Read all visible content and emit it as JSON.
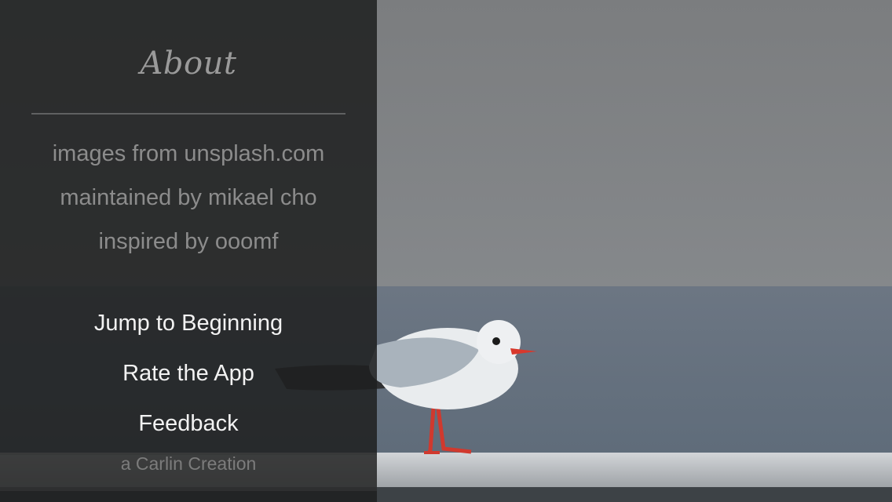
{
  "sidebar": {
    "title": "About",
    "credits": [
      "images from unsplash.com",
      "maintained by mikael cho",
      "inspired by ooomf"
    ],
    "menu": [
      "Jump to Beginning",
      "Rate the App",
      "Feedback"
    ],
    "signature": "a Carlin Creation"
  },
  "background": {
    "subject": "seagull-photo",
    "colors": {
      "sky": "#7d8083",
      "sea": "#66717c",
      "railing": "#bfc3c6",
      "beak_and_legs": "#d63a2e"
    }
  }
}
